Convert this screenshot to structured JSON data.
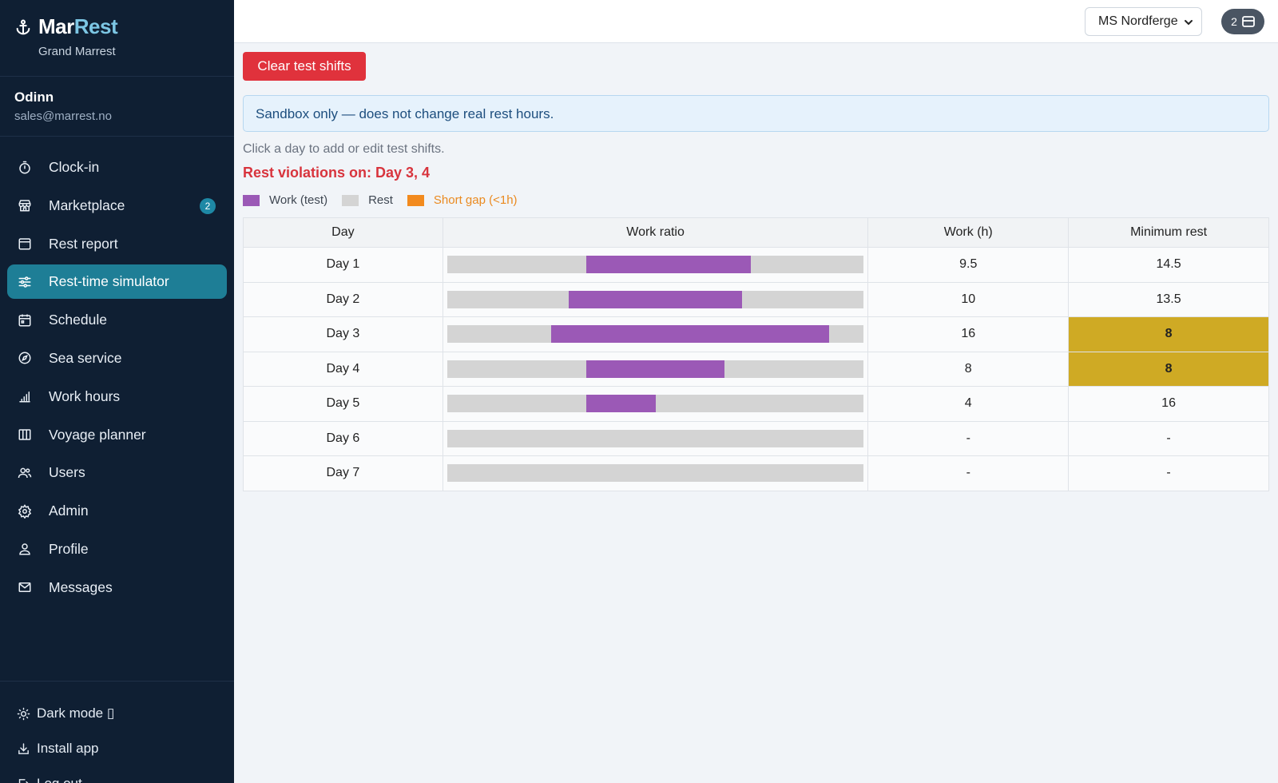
{
  "brand": {
    "name_part1": "Mar",
    "name_part2": "Rest",
    "subtitle": "Grand Marrest"
  },
  "user": {
    "name": "Odinn",
    "email": "sales@marrest.no"
  },
  "nav": [
    {
      "label": "Clock-in",
      "icon": "stopwatch-icon"
    },
    {
      "label": "Marketplace",
      "icon": "store-icon",
      "badge": "2"
    },
    {
      "label": "Rest report",
      "icon": "calendar-grid-icon"
    },
    {
      "label": "Rest-time simulator",
      "icon": "sliders-icon",
      "active": true
    },
    {
      "label": "Schedule",
      "icon": "calendar-icon"
    },
    {
      "label": "Sea service",
      "icon": "compass-icon"
    },
    {
      "label": "Work hours",
      "icon": "bar-chart-icon"
    },
    {
      "label": "Voyage planner",
      "icon": "map-icon"
    },
    {
      "label": "Users",
      "icon": "users-icon"
    },
    {
      "label": "Admin",
      "icon": "gear-icon"
    },
    {
      "label": "Profile",
      "icon": "person-icon"
    },
    {
      "label": "Messages",
      "icon": "envelope-icon"
    }
  ],
  "bottom": {
    "dark_mode": "Dark mode ▯",
    "install": "Install app",
    "logout": "Log out"
  },
  "topbar": {
    "vessel": "MS Nordferge",
    "notif_count": "2"
  },
  "main": {
    "clear_button": "Clear test shifts",
    "info": "Sandbox only — does not change real rest hours.",
    "hint": "Click a day to add or edit test shifts.",
    "violations": "Rest violations on: Day 3, 4",
    "legend": [
      {
        "label": "Work (test)",
        "color": "#9b59b6"
      },
      {
        "label": "Rest",
        "color": "#d4d4d4"
      },
      {
        "label": "Short gap (<1h)",
        "color": "#f28a1e"
      }
    ]
  },
  "table": {
    "headers": [
      "Day",
      "Work ratio",
      "Work (h)",
      "Minimum rest"
    ],
    "rows": [
      {
        "day": "Day 1",
        "work_start": 8,
        "work_end": 17.5,
        "work_h": "9.5",
        "min_rest": "14.5",
        "violation": false
      },
      {
        "day": "Day 2",
        "work_start": 7,
        "work_end": 17,
        "work_h": "10",
        "min_rest": "13.5",
        "violation": false
      },
      {
        "day": "Day 3",
        "work_start": 6,
        "work_end": 22,
        "work_h": "16",
        "min_rest": "8",
        "violation": true
      },
      {
        "day": "Day 4",
        "work_start": 8,
        "work_end": 16,
        "work_h": "8",
        "min_rest": "8",
        "violation": true
      },
      {
        "day": "Day 5",
        "work_start": 8,
        "work_end": 12,
        "work_h": "4",
        "min_rest": "16",
        "violation": false
      },
      {
        "day": "Day 6",
        "work_start": null,
        "work_end": null,
        "work_h": "-",
        "min_rest": "-",
        "violation": false
      },
      {
        "day": "Day 7",
        "work_start": null,
        "work_end": null,
        "work_h": "-",
        "min_rest": "-",
        "violation": false
      }
    ]
  }
}
